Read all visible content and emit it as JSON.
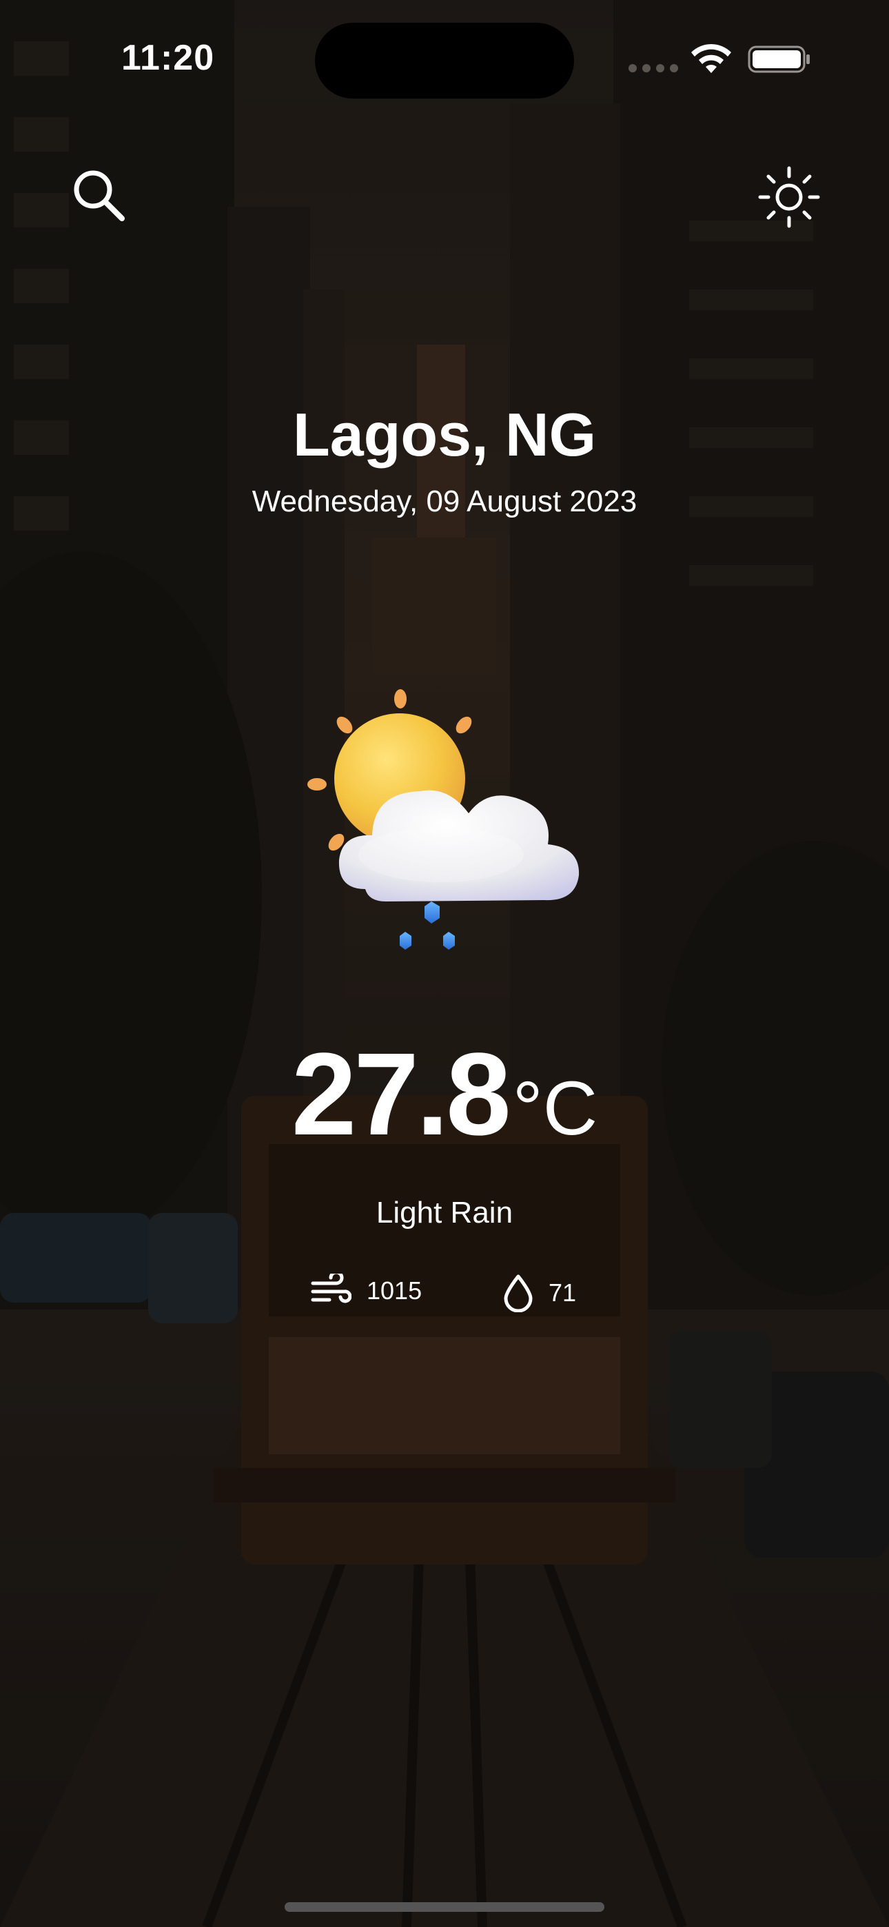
{
  "status_bar": {
    "time": "11:20",
    "icons": [
      "signal-icon",
      "wifi-icon",
      "battery-icon"
    ]
  },
  "header": {
    "search_icon": "search-icon",
    "theme_icon": "sun-icon"
  },
  "location": {
    "city": "Lagos, NG",
    "date": "Wednesday, 09 August 2023"
  },
  "weather": {
    "icon": "sun-cloud-rain-icon",
    "temperature": "27.8",
    "unit": "°C",
    "condition": "Light Rain"
  },
  "stats": {
    "pressure": {
      "icon": "wind-icon",
      "value": "1015"
    },
    "humidity": {
      "icon": "droplet-icon",
      "value": "71"
    }
  },
  "colors": {
    "background_overlay": "#1a1612",
    "text": "#ffffff",
    "sun": "#f5c542",
    "rain": "#3d8ef5"
  }
}
